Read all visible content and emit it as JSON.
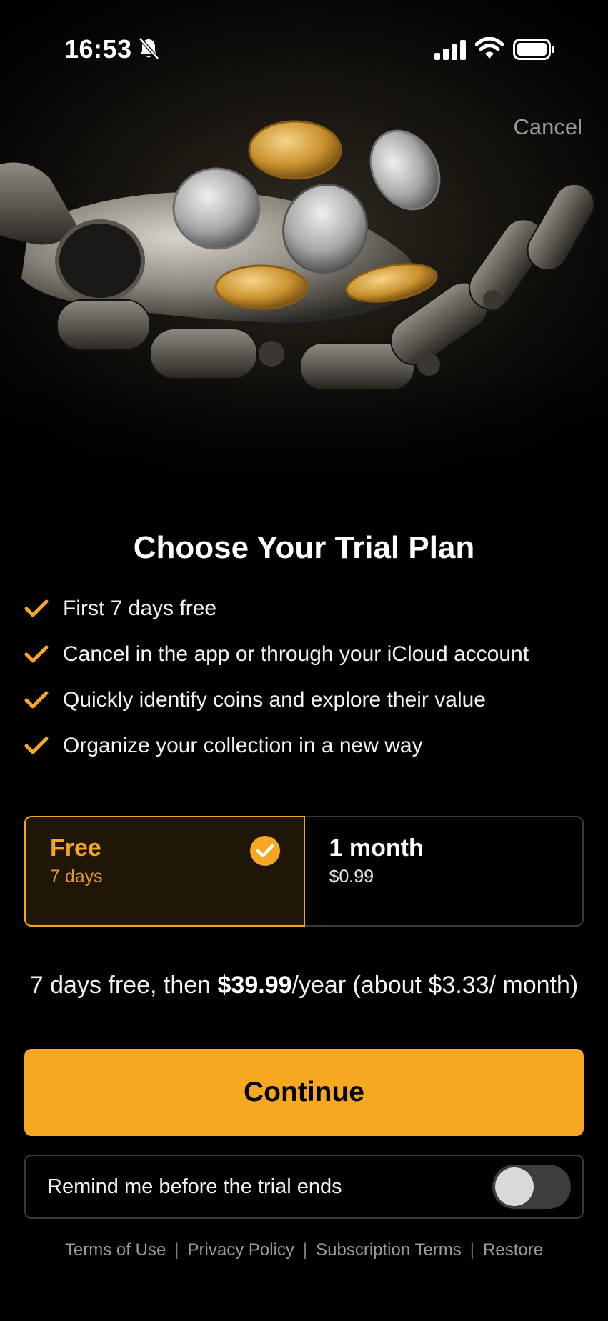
{
  "status_bar": {
    "time": "16:53",
    "icons": [
      "bell-slash-icon",
      "signal-icon",
      "wifi-icon",
      "battery-icon"
    ]
  },
  "header": {
    "cancel_label": "Cancel"
  },
  "title": "Choose Your Trial Plan",
  "features": [
    "First 7 days free",
    "Cancel in the app or through your iCloud account",
    "Quickly identify coins and explore their value",
    "Organize your collection in a new way"
  ],
  "plans": [
    {
      "name": "Free",
      "sub": "7 days",
      "selected": true
    },
    {
      "name": "1 month",
      "sub": "$0.99",
      "selected": false
    }
  ],
  "price_line": {
    "prefix": "7 days free, then ",
    "price": "$39.99",
    "suffix": "/year (about $3.33/ month)"
  },
  "continue_label": "Continue",
  "reminder": {
    "label": "Remind me before the trial ends",
    "enabled": false
  },
  "footer_links": [
    "Terms of Use",
    "Privacy Policy",
    "Subscription Terms",
    "Restore"
  ],
  "colors": {
    "accent": "#f7a823",
    "background": "#000000",
    "muted_text": "#9a9a9a"
  }
}
